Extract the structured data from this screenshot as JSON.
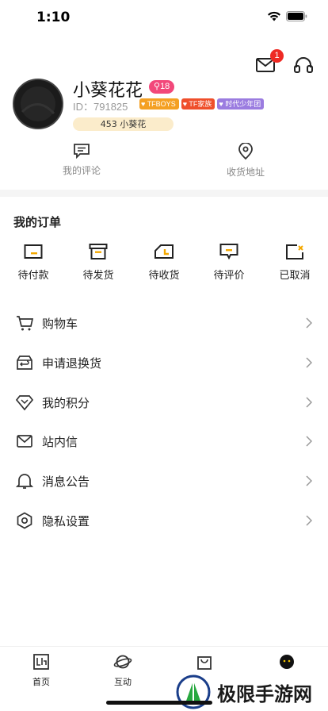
{
  "status_bar": {
    "time": "1:10"
  },
  "header": {
    "message_badge": "1"
  },
  "profile": {
    "username": "小葵花花",
    "level": "18",
    "user_id": "ID：791825",
    "tags": [
      "TFBOYS",
      "TF家族",
      "时代少年团"
    ],
    "points_label": "453 小葵花"
  },
  "quick_links": [
    {
      "label": "我的评论",
      "icon": "comment-icon"
    },
    {
      "label": "收货地址",
      "icon": "location-icon"
    }
  ],
  "orders": {
    "title": "我的订单",
    "items": [
      {
        "label": "待付款",
        "icon": "wallet-icon"
      },
      {
        "label": "待发货",
        "icon": "box-icon"
      },
      {
        "label": "待收货",
        "icon": "truck-icon"
      },
      {
        "label": "待评价",
        "icon": "review-icon"
      },
      {
        "label": "已取消",
        "icon": "cancelled-icon"
      }
    ]
  },
  "menu": [
    {
      "label": "购物车",
      "icon": "cart-icon"
    },
    {
      "label": "申请退换货",
      "icon": "return-icon"
    },
    {
      "label": "我的积分",
      "icon": "diamond-icon"
    },
    {
      "label": "站内信",
      "icon": "mail-icon"
    },
    {
      "label": "消息公告",
      "icon": "bell-icon"
    },
    {
      "label": "隐私设置",
      "icon": "settings-icon"
    }
  ],
  "tab_bar": [
    {
      "label": "首页",
      "icon": "home-icon"
    },
    {
      "label": "互动",
      "icon": "planet-icon"
    },
    {
      "label": "",
      "icon": "shop-bag-icon"
    },
    {
      "label": "",
      "icon": "profile-face-icon"
    }
  ],
  "watermark": {
    "text": "极限手游网"
  }
}
